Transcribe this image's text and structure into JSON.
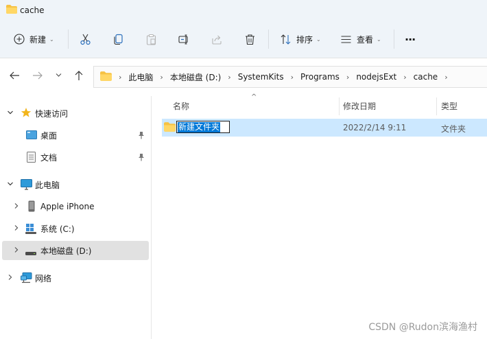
{
  "window": {
    "title": "cache"
  },
  "toolbar": {
    "new_label": "新建",
    "sort_label": "排序",
    "view_label": "查看",
    "more_label": "···"
  },
  "breadcrumb": [
    "此电脑",
    "本地磁盘 (D:)",
    "SystemKits",
    "Programs",
    "nodejsExt",
    "cache"
  ],
  "sidebar": {
    "items": [
      {
        "label": "快速访问"
      },
      {
        "label": "桌面"
      },
      {
        "label": "文档"
      },
      {
        "label": "此电脑"
      },
      {
        "label": "Apple iPhone"
      },
      {
        "label": "系统 (C:)"
      },
      {
        "label": "本地磁盘 (D:)"
      },
      {
        "label": "网络"
      }
    ]
  },
  "columns": {
    "name": "名称",
    "modified": "修改日期",
    "type": "类型"
  },
  "files": [
    {
      "name": "新建文件夹",
      "modified": "2022/2/14 9:11",
      "type": "文件夹"
    }
  ],
  "watermark": "CSDN @Rudon滨海渔村",
  "colors": {
    "accent": "#0078d7",
    "selection": "#cce8ff",
    "folder": "#f6c244",
    "chrome": "#eff4f9"
  }
}
